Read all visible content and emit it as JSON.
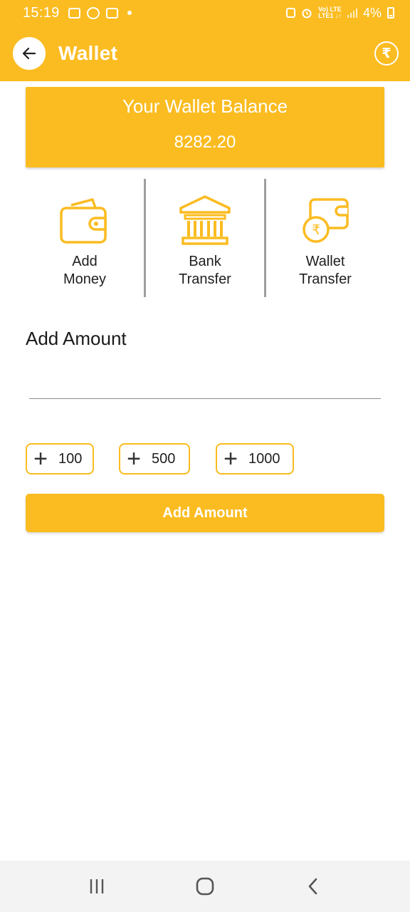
{
  "status_bar": {
    "time": "15:19",
    "network_top": "Vo) LTE",
    "network_bottom": "LTE1 ↓↑",
    "battery": "4%"
  },
  "app_bar": {
    "title": "Wallet",
    "back_icon": "arrow-left-icon",
    "action_icon": "rupee-icon"
  },
  "balance": {
    "label": "Your Wallet Balance",
    "value": "8282.20"
  },
  "actions": [
    {
      "line1": "Add",
      "line2": "Money",
      "icon": "wallet-icon"
    },
    {
      "line1": "Bank",
      "line2": "Transfer",
      "icon": "bank-icon"
    },
    {
      "line1": "Wallet",
      "line2": "Transfer",
      "icon": "wallet-transfer-icon"
    }
  ],
  "form": {
    "title": "Add Amount",
    "amount_value": "",
    "amount_placeholder": ""
  },
  "quick_amounts": [
    "100",
    "500",
    "1000"
  ],
  "submit_label": "Add Amount",
  "colors": {
    "accent": "#FBBC21",
    "white": "#FFFFFF",
    "text": "#1F1F1F"
  }
}
